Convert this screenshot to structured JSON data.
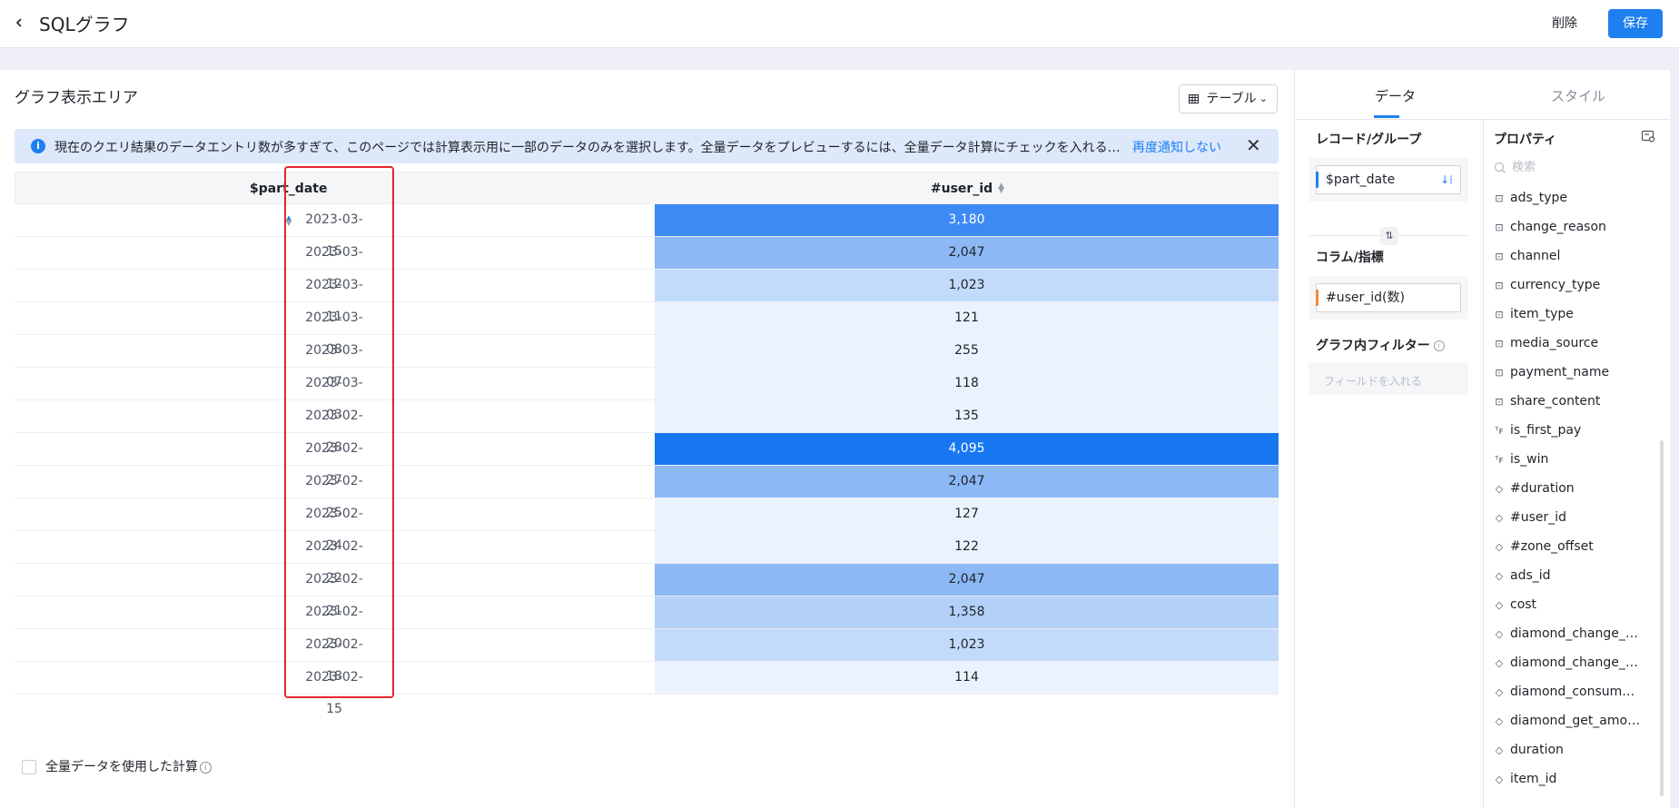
{
  "header": {
    "title": "SQLグラフ",
    "delete_label": "削除",
    "save_label": "保存"
  },
  "main": {
    "area_title": "グラフ表示エリア",
    "view_select": "テーブル",
    "banner": {
      "message": "現在のクエリ結果のデータエントリ数が多すぎて、このページでは計算表示用に一部のデータのみを選択します。全量データをプレビューするには、全量データ計算にチェックを入れる…",
      "link": "再度通知しない"
    },
    "table": {
      "columns": [
        "$part_date",
        "#user_id"
      ],
      "rows": [
        {
          "date": "2023-03-15",
          "value": "3,180",
          "color": "#3d8af5"
        },
        {
          "date": "2023-03-12",
          "value": "2,047",
          "color": "#8cb8f6"
        },
        {
          "date": "2023-03-11",
          "value": "1,023",
          "color": "#c3dbfa"
        },
        {
          "date": "2023-03-08",
          "value": "121",
          "color": "#eaf2fd"
        },
        {
          "date": "2023-03-07",
          "value": "255",
          "color": "#eaf2fd"
        },
        {
          "date": "2023-03-03",
          "value": "118",
          "color": "#eaf2fd"
        },
        {
          "date": "2023-02-28",
          "value": "135",
          "color": "#eaf2fd"
        },
        {
          "date": "2023-02-27",
          "value": "4,095",
          "color": "#1677f0"
        },
        {
          "date": "2023-02-25",
          "value": "2,047",
          "color": "#8cb8f6"
        },
        {
          "date": "2023-02-24",
          "value": "127",
          "color": "#eaf2fd"
        },
        {
          "date": "2023-02-22",
          "value": "122",
          "color": "#eaf2fd"
        },
        {
          "date": "2023-02-21",
          "value": "2,047",
          "color": "#8cb8f6"
        },
        {
          "date": "2023-02-20",
          "value": "1,358",
          "color": "#b3d0f8"
        },
        {
          "date": "2023-02-18",
          "value": "1,023",
          "color": "#c3dbfa"
        },
        {
          "date": "2023-02-15",
          "value": "114",
          "color": "#eaf2fd"
        }
      ]
    },
    "full_calc_label": "全量データを使用した計算"
  },
  "side": {
    "tabs": [
      "データ",
      "スタイル"
    ],
    "record_group_title": "レコード/グループ",
    "record_field": "$part_date",
    "column_metric_title": "コラム/指標",
    "metric_field": "#user_id(数)",
    "filter_title": "グラフ内フィルター",
    "filter_placeholder": "フィールドを入れる",
    "properties_title": "プロパティ",
    "search_placeholder": "検索",
    "properties": [
      {
        "type": "str",
        "name": "ads_type"
      },
      {
        "type": "str",
        "name": "change_reason"
      },
      {
        "type": "str",
        "name": "channel"
      },
      {
        "type": "str",
        "name": "currency_type"
      },
      {
        "type": "str",
        "name": "item_type"
      },
      {
        "type": "str",
        "name": "media_source"
      },
      {
        "type": "str",
        "name": "payment_name"
      },
      {
        "type": "str",
        "name": "share_content"
      },
      {
        "type": "bool",
        "name": "is_first_pay"
      },
      {
        "type": "bool",
        "name": "is_win"
      },
      {
        "type": "num",
        "name": "#duration"
      },
      {
        "type": "num",
        "name": "#user_id"
      },
      {
        "type": "num",
        "name": "#zone_offset"
      },
      {
        "type": "num",
        "name": "ads_id"
      },
      {
        "type": "num",
        "name": "cost"
      },
      {
        "type": "num",
        "name": "diamond_change_…"
      },
      {
        "type": "num",
        "name": "diamond_change_…"
      },
      {
        "type": "num",
        "name": "diamond_consum…"
      },
      {
        "type": "num",
        "name": "diamond_get_amo…"
      },
      {
        "type": "num",
        "name": "duration"
      },
      {
        "type": "num",
        "name": "item_id"
      }
    ]
  }
}
